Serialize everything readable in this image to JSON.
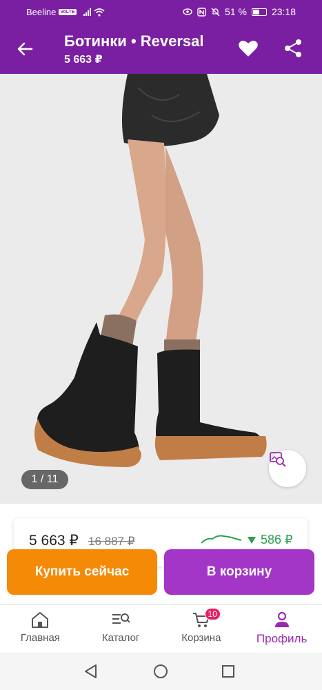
{
  "status": {
    "carrier": "Beeline",
    "volte": "VoLTE",
    "battery": "51 %",
    "time": "23:18"
  },
  "header": {
    "title": "Ботинки • Reversal",
    "price": "5 663 ₽"
  },
  "gallery": {
    "indicator": "1 / 11"
  },
  "price_card": {
    "current": "5 663 ₽",
    "old": "16 887 ₽",
    "diff": "586 ₽"
  },
  "actions": {
    "buy_now": "Купить сейчас",
    "add_to_cart": "В корзину"
  },
  "nav": {
    "items": [
      {
        "label": "Главная"
      },
      {
        "label": "Каталог"
      },
      {
        "label": "Корзина",
        "badge": "10"
      },
      {
        "label": "Профиль"
      }
    ]
  },
  "colors": {
    "primary": "#7b1fa2",
    "buy": "#f58a07",
    "cart": "#a335c7",
    "active_nav": "#9c27b0",
    "diff_green": "#2e9e4f"
  }
}
